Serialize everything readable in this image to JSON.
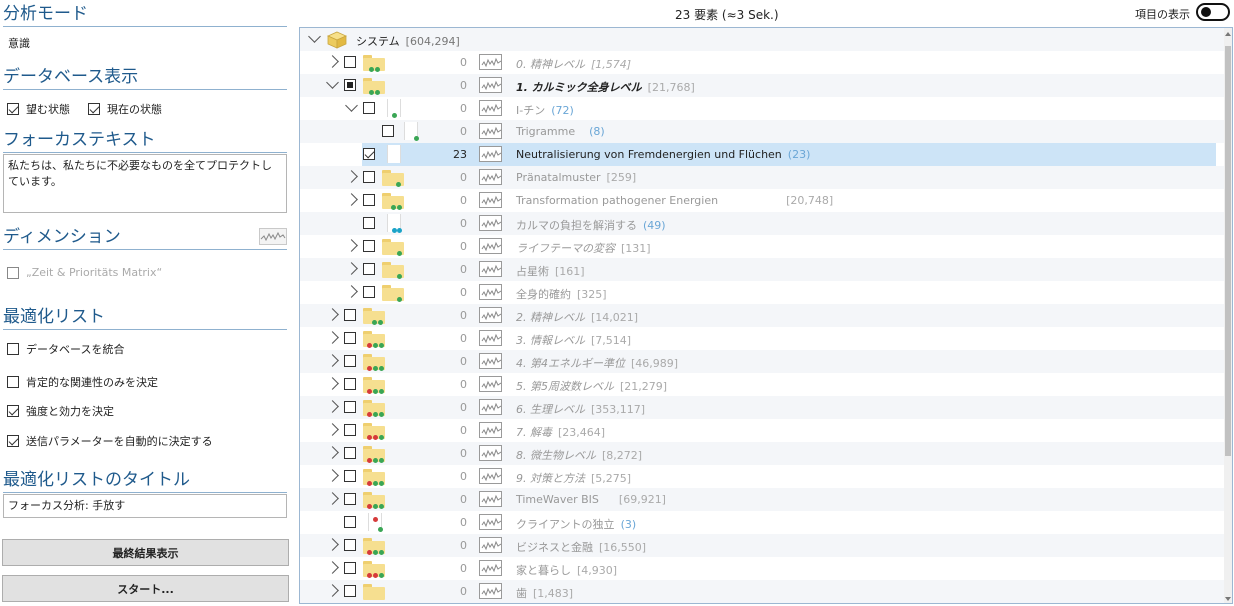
{
  "left": {
    "analysis_mode": {
      "title": "分析モード",
      "value": "意識"
    },
    "database_display": {
      "title": "データベース表示",
      "options": [
        {
          "label": "望む状態",
          "checked": true
        },
        {
          "label": "現在の状態",
          "checked": true
        }
      ]
    },
    "focus_text": {
      "title": "フォーカステキスト",
      "value": "私たちは、私たちに不必要なものを全てプロテクトしています。"
    },
    "dimension": {
      "title": "ディメンション",
      "option": {
        "label": "„Zeit & Prioritäts Matrix“",
        "checked": false
      }
    },
    "optimization_list": {
      "title": "最適化リスト",
      "options": [
        {
          "label": "データベースを統合",
          "checked": false
        },
        {
          "label": "肯定的な関連性のみを決定",
          "checked": false
        },
        {
          "label": "強度と効力を決定",
          "checked": true
        },
        {
          "label": "送信パラメーターを自動的に決定する",
          "checked": true
        }
      ]
    },
    "optimization_title": {
      "title": "最適化リストのタイトル",
      "value": "フォーカス分析: 手放す"
    },
    "buttons": {
      "final_result": "最終結果表示",
      "start": "スタート..."
    }
  },
  "status": {
    "count_text": "23 要素 (≈3 Sek.)",
    "toggle_label": "項目の表示"
  },
  "tree": {
    "root": {
      "label": "システム",
      "count": "[604,294]"
    },
    "rows": [
      {
        "label": "0. 精神レベル",
        "count": "[1,574]",
        "value": "0"
      },
      {
        "label": "1. カルミック全身レベル",
        "count": "[21,768]",
        "value": "0"
      },
      {
        "label": "I-チン",
        "count": "(72)",
        "value": "0"
      },
      {
        "label": "Trigramme",
        "count": "(8)",
        "value": "0"
      },
      {
        "label": "Neutralisierung von Fremdenergien und Flüchen",
        "count": "(23)",
        "value": "23"
      },
      {
        "label": "Pränatalmuster",
        "count": "[259]",
        "value": "0"
      },
      {
        "label": "Transformation pathogener Energien",
        "count": "[20,748]",
        "value": "0"
      },
      {
        "label": "カルマの負担を解消する",
        "count": "(49)",
        "value": "0"
      },
      {
        "label": "ライフテーマの変容",
        "count": "[131]",
        "value": "0"
      },
      {
        "label": "占星術",
        "count": "[161]",
        "value": "0"
      },
      {
        "label": "全身的確約",
        "count": "[325]",
        "value": "0"
      },
      {
        "label": "2. 精神レベル",
        "count": "[14,021]",
        "value": "0"
      },
      {
        "label": "3. 情報レベル",
        "count": "[7,514]",
        "value": "0"
      },
      {
        "label": "4. 第4エネルギー準位",
        "count": "[46,989]",
        "value": "0"
      },
      {
        "label": "5. 第5周波数レベル",
        "count": "[21,279]",
        "value": "0"
      },
      {
        "label": "6. 生理レベル",
        "count": "[353,117]",
        "value": "0"
      },
      {
        "label": "7. 解毒",
        "count": "[23,464]",
        "value": "0"
      },
      {
        "label": "8. 微生物レベル",
        "count": "[8,272]",
        "value": "0"
      },
      {
        "label": "9. 対策と方法",
        "count": "[5,275]",
        "value": "0"
      },
      {
        "label": "TimeWaver BIS",
        "count": "[69,921]",
        "value": "0"
      },
      {
        "label": "クライアントの独立",
        "count": "(3)",
        "value": "0"
      },
      {
        "label": "ビジネスと金融",
        "count": "[16,550]",
        "value": "0"
      },
      {
        "label": "家と暮らし",
        "count": "[4,930]",
        "value": "0"
      },
      {
        "label": "歯",
        "count": "[1,483]",
        "value": "0"
      }
    ]
  }
}
